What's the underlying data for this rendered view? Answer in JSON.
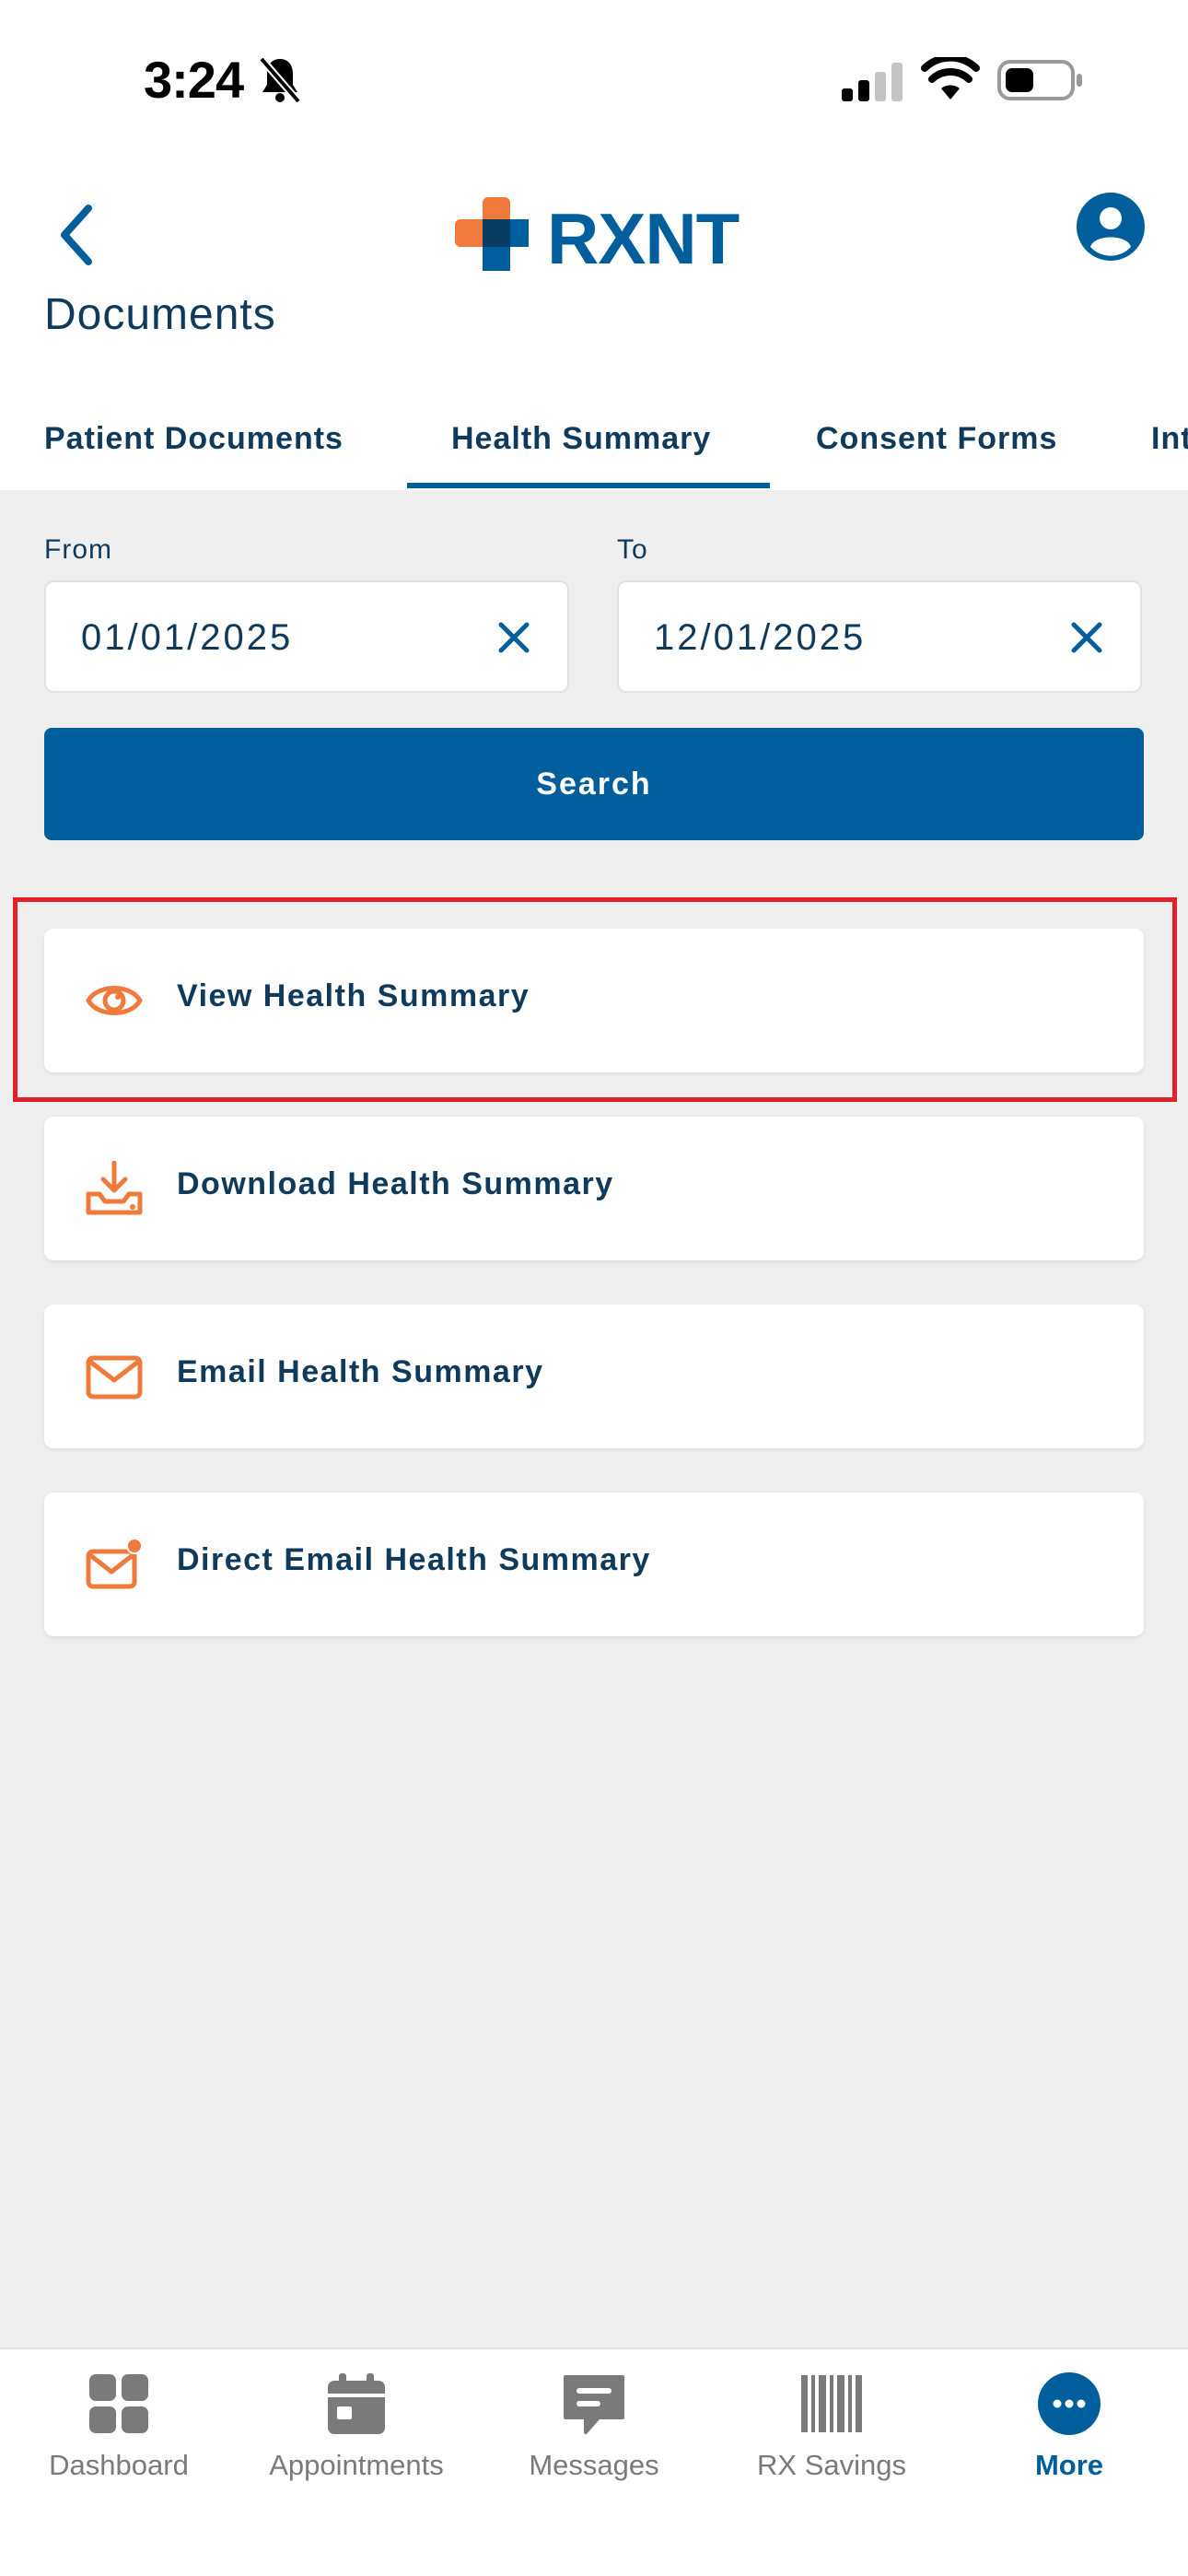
{
  "status_bar": {
    "time": "3:24"
  },
  "header": {
    "logo_text": "RXNT",
    "page_title": "Documents"
  },
  "tabs": [
    {
      "label": "Patient Documents"
    },
    {
      "label": "Health Summary"
    },
    {
      "label": "Consent Forms"
    },
    {
      "label": "Int"
    }
  ],
  "active_tab": "Health Summary",
  "filters": {
    "from_label": "From",
    "from_value": "01/01/2025",
    "to_label": "To",
    "to_value": "12/01/2025",
    "search_label": "Search"
  },
  "actions": [
    {
      "label": "View Health Summary",
      "icon": "eye-icon"
    },
    {
      "label": "Download Health Summary",
      "icon": "download-icon"
    },
    {
      "label": "Email Health Summary",
      "icon": "mail-icon"
    },
    {
      "label": "Direct Email Health Summary",
      "icon": "mail-dot-icon"
    }
  ],
  "bottom_nav": [
    {
      "label": "Dashboard",
      "icon": "dashboard-icon"
    },
    {
      "label": "Appointments",
      "icon": "calendar-icon"
    },
    {
      "label": "Messages",
      "icon": "message-icon"
    },
    {
      "label": "RX Savings",
      "icon": "barcode-icon"
    },
    {
      "label": "More",
      "icon": "more-icon"
    }
  ],
  "active_nav": "More",
  "colors": {
    "brand_blue": "#005e9c",
    "accent_orange": "#f07a3c",
    "text_dark": "#0f3a5c",
    "highlight_red": "#e0202a",
    "background": "#efefef"
  }
}
